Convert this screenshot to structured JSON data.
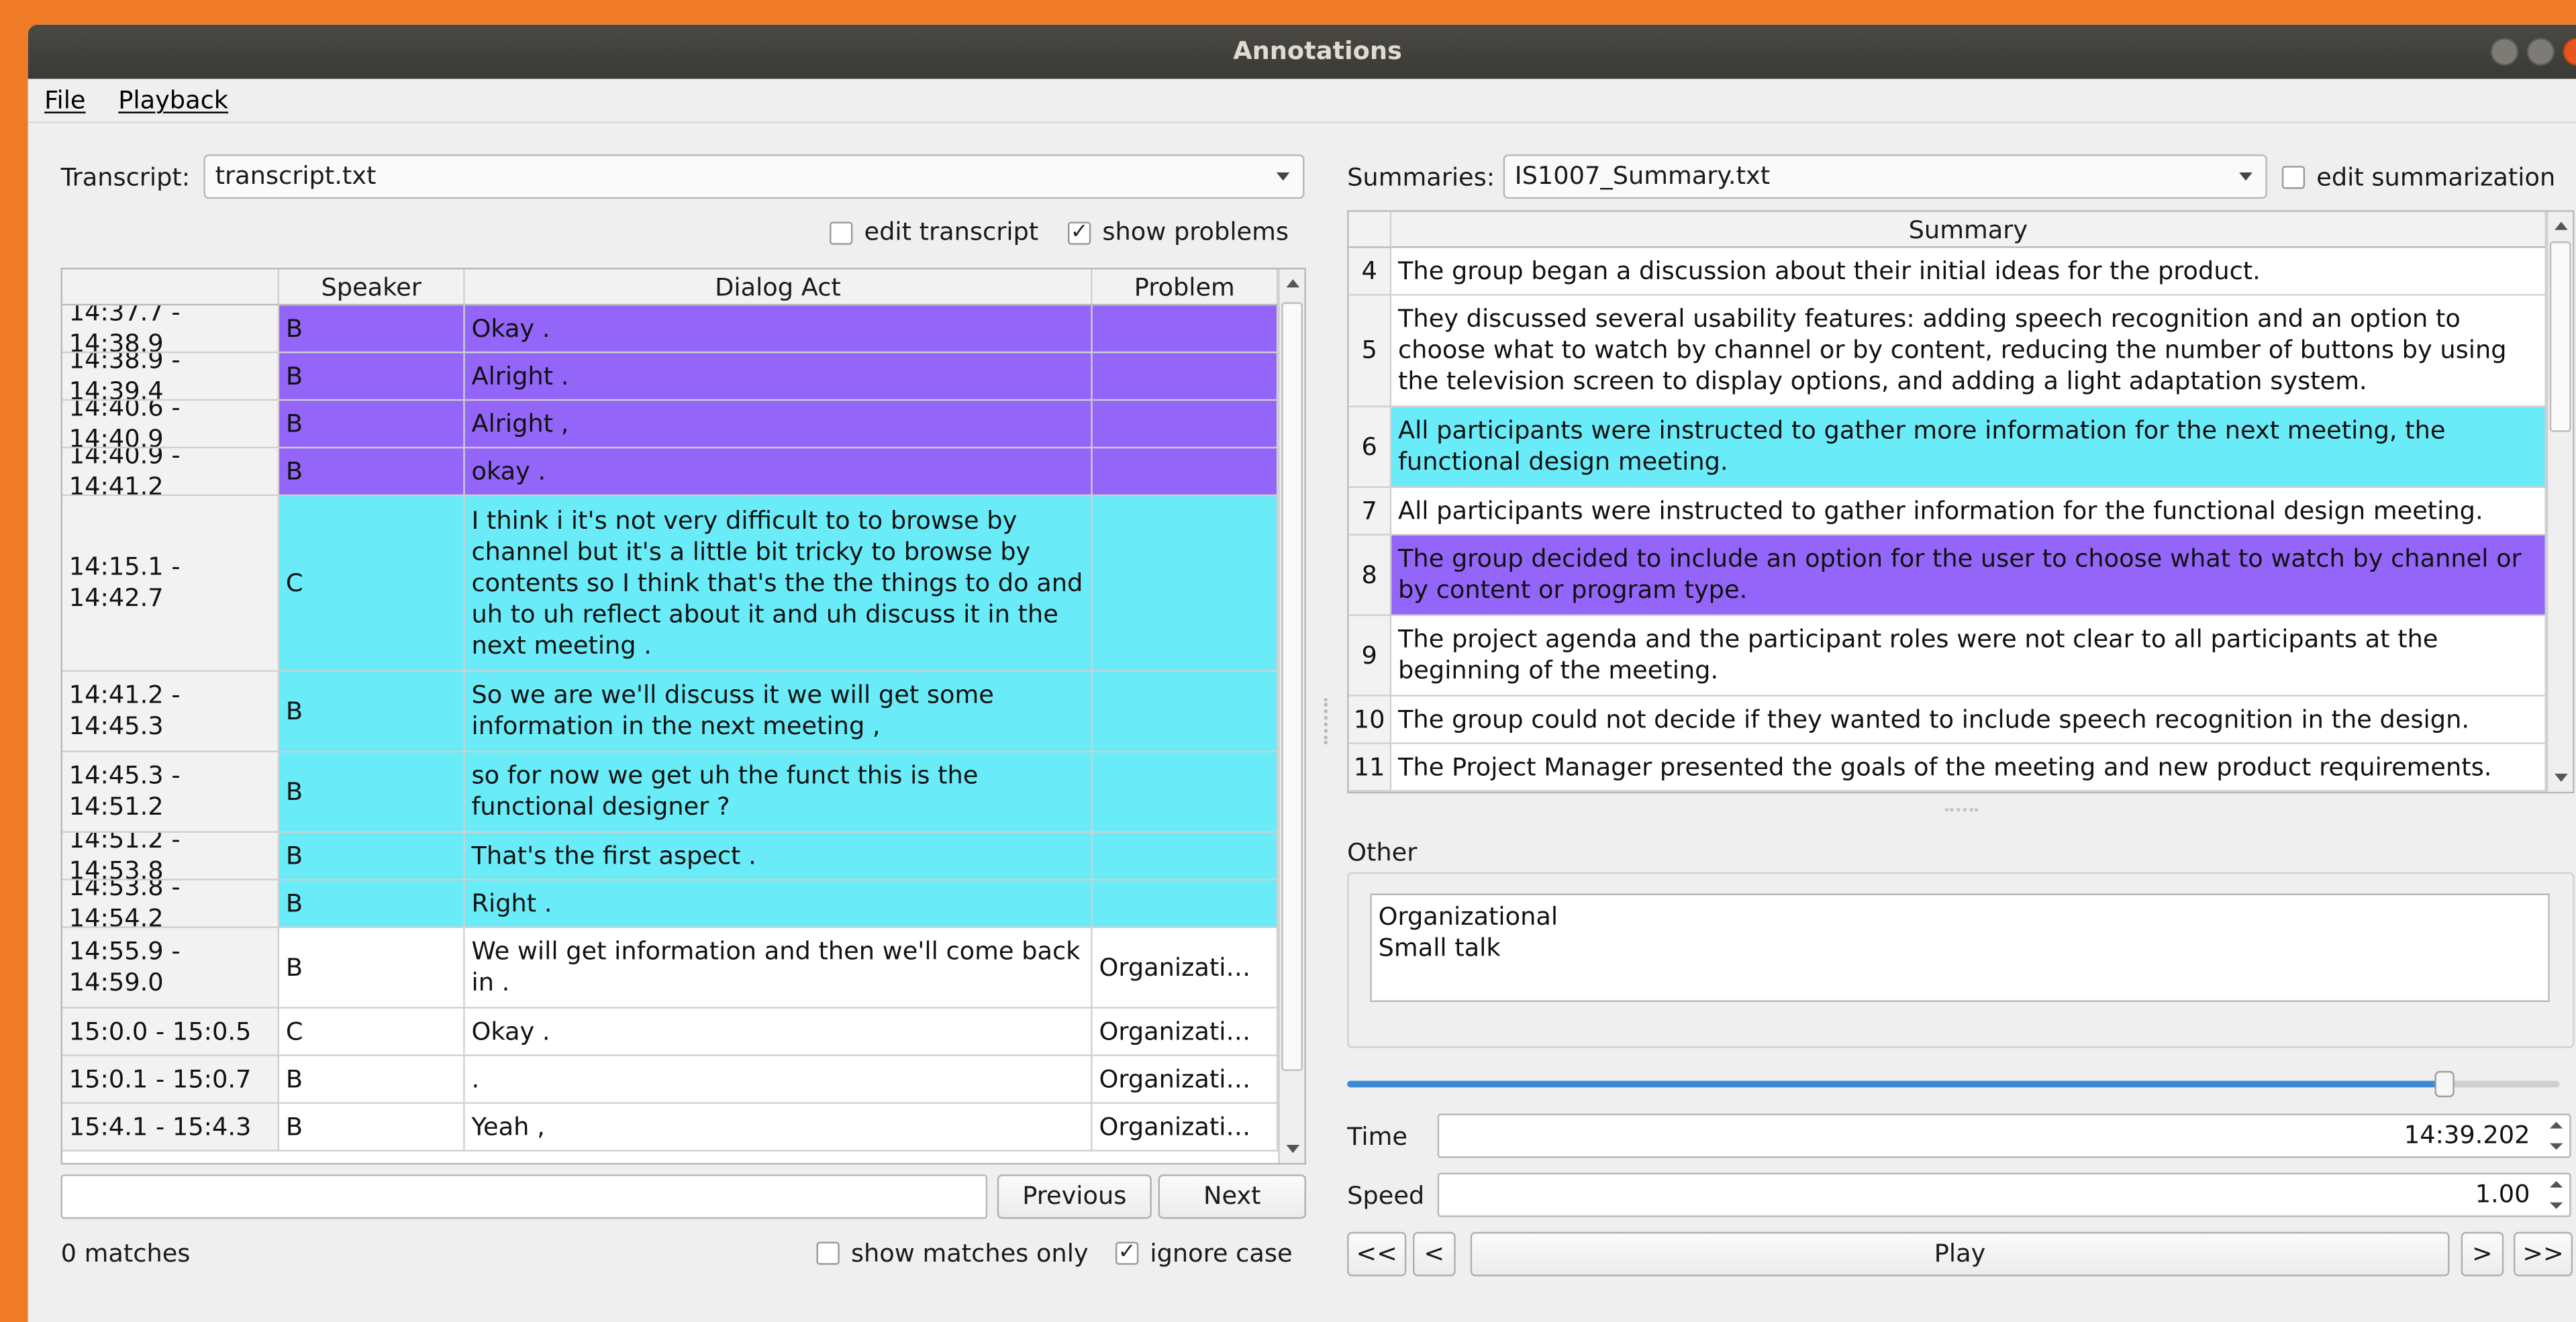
{
  "window": {
    "title": "Annotations"
  },
  "menu": {
    "file": "File",
    "playback": "Playback"
  },
  "transcript": {
    "label": "Transcript:",
    "file": "transcript.txt",
    "edit_label": "edit transcript",
    "edit_checked": false,
    "show_problems_label": "show problems",
    "show_problems_checked": true,
    "columns": [
      "Speaker",
      "Dialog Act",
      "Problem"
    ],
    "rows": [
      {
        "time": "14:37.7 - 14:38.9",
        "speaker": "B",
        "act": "Okay .",
        "problem": "",
        "color": "#9365f9"
      },
      {
        "time": "14:38.9 - 14:39.4",
        "speaker": "B",
        "act": "Alright .",
        "problem": "",
        "color": "#9365f9"
      },
      {
        "time": "14:40.6 - 14:40.9",
        "speaker": "B",
        "act": "Alright ,",
        "problem": "",
        "color": "#9365f9"
      },
      {
        "time": "14:40.9 - 14:41.2",
        "speaker": "B",
        "act": "okay .",
        "problem": "",
        "color": "#9365f9"
      },
      {
        "time": "14:15.1 - 14:42.7",
        "speaker": "C",
        "act": "I think i it's not very difficult to to browse by channel but it's a little bit tricky to browse by contents so I think that's the the things to do and uh to uh reflect about it and uh discuss it in the next meeting .",
        "problem": "",
        "color": "#6aebf8"
      },
      {
        "time": "14:41.2 - 14:45.3",
        "speaker": "B",
        "act": "So we are we'll discuss it we will get some information in the next meeting ,",
        "problem": "",
        "color": "#6aebf8"
      },
      {
        "time": "14:45.3 - 14:51.2",
        "speaker": "B",
        "act": "so for now we get uh the funct this is the functional designer ?",
        "problem": "",
        "color": "#6aebf8"
      },
      {
        "time": "14:51.2 - 14:53.8",
        "speaker": "B",
        "act": "That's the first aspect .",
        "problem": "",
        "color": "#6aebf8"
      },
      {
        "time": "14:53.8 - 14:54.2",
        "speaker": "B",
        "act": "Right .",
        "problem": "",
        "color": "#6aebf8"
      },
      {
        "time": "14:55.9 - 14:59.0",
        "speaker": "B",
        "act": "We will get information and then we'll come back in .",
        "problem": "Organizati…",
        "color": "#ffffff"
      },
      {
        "time": "15:0.0 - 15:0.5",
        "speaker": "C",
        "act": "Okay .",
        "problem": "Organizati…",
        "color": "#ffffff"
      },
      {
        "time": "15:0.1 - 15:0.7",
        "speaker": "B",
        "act": ".",
        "problem": "Organizati…",
        "color": "#ffffff"
      },
      {
        "time": "15:4.1 - 15:4.3",
        "speaker": "B",
        "act": "Yeah ,",
        "problem": "Organizati…",
        "color": "#ffffff"
      }
    ]
  },
  "search": {
    "value": "",
    "previous_label": "Previous",
    "next_label": "Next",
    "matches": "0 matches",
    "matches_only_label": "show matches only",
    "matches_only_checked": false,
    "ignore_case_label": "ignore case",
    "ignore_case_checked": true
  },
  "summaries": {
    "label": "Summaries:",
    "file": "IS1007_Summary.txt",
    "edit_label": "edit summarization",
    "edit_checked": false,
    "column": "Summary",
    "rows": [
      {
        "num": "4",
        "text": "The group began a discussion about their initial ideas for the product.",
        "color": "#ffffff"
      },
      {
        "num": "5",
        "text": "They discussed several usability features: adding speech recognition and an option to choose what to watch by channel or by content, reducing the number of buttons by using the television screen to display options, and adding a light adaptation system.",
        "color": "#ffffff"
      },
      {
        "num": "6",
        "text": "All participants were instructed to gather more information for the next meeting, the functional design meeting.",
        "color": "#6aebf8"
      },
      {
        "num": "7",
        "text": "All participants were instructed to gather information for the functional design meeting.",
        "color": "#ffffff"
      },
      {
        "num": "8",
        "text": "The group decided to include an option for the user to choose what to watch by channel or by content or program type.",
        "color": "#9365f9"
      },
      {
        "num": "9",
        "text": "The project agenda and the participant roles were not clear to all participants at the beginning of the meeting.",
        "color": "#ffffff"
      },
      {
        "num": "10",
        "text": "The group could not decide if they wanted to include speech recognition in the design.",
        "color": "#ffffff"
      },
      {
        "num": "11",
        "text": "The Project Manager presented the goals of the meeting and new product requirements.",
        "color": "#ffffff"
      }
    ]
  },
  "other": {
    "label": "Other",
    "lines": [
      "Organizational",
      "Small talk"
    ]
  },
  "playback": {
    "progress": 0.905,
    "time_label": "Time",
    "time_value": "14:39.202",
    "speed_label": "Speed",
    "speed_value": "1.00",
    "rewind_fast": "<<",
    "rewind": "<",
    "play": "Play",
    "forward": ">",
    "forward_fast": ">>"
  }
}
